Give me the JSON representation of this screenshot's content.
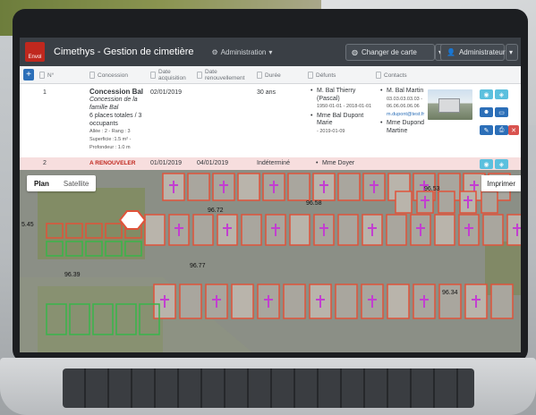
{
  "app": {
    "title": "Cimethys - Gestion de cimetière",
    "logo_text": "Envol",
    "admin_menu": "Administration",
    "change_map_button": "Changer de carte",
    "user_button": "Administrateur"
  },
  "table": {
    "headers": [
      "N°",
      "Concession",
      "Date acquisition",
      "Date renouvellement",
      "Durée",
      "Défunts",
      "Contacts"
    ],
    "row1": {
      "number": "1",
      "concession_title": "Concession Bal",
      "concession_family": "Concession de la famille Bal",
      "places": "6 places totales / 3 occupants",
      "details": [
        "Allée : 2 - Rang : 3",
        "Superficie :1.5 m² -",
        "Profondeur : 1.0 m"
      ],
      "date_acquisition": "02/01/2019",
      "date_renouvellement": "",
      "duree": "30 ans",
      "defunts": [
        {
          "name": "M. Bal Thierry (Pascal)",
          "dates": "1950-01-01 - 2018-01-01"
        },
        {
          "name": "Mme Bal Dupont Marie",
          "dates": "- 2019-01-09"
        }
      ],
      "contacts": [
        {
          "name": "M. Bal Martin",
          "phones": [
            "03.03.03.03.03 -",
            "06.06.06.06.06"
          ],
          "email": "m.dupont@test.fr"
        },
        {
          "name": "Mme Dupond Martine",
          "phones": [],
          "email": ""
        }
      ]
    },
    "row2": {
      "number": "2",
      "status": "A RENOUVELER",
      "date_acquisition": "01/01/2019",
      "date_renouvellement": "04/01/2019",
      "duree": "Indéterminé",
      "defunt": "Mme Doyer"
    }
  },
  "map": {
    "tabs": [
      "Plan",
      "Satellite"
    ],
    "active_tab": "Plan",
    "print_button": "Imprimer",
    "elevations": [
      "96.72",
      "96.58",
      "96.53",
      "96.77",
      "96.39",
      "96.34",
      "5.45"
    ]
  },
  "colors": {
    "header_bg": "#3a3f45",
    "accent_blue": "#2c6fb8",
    "danger": "#d9534f",
    "renew_row": "#f7dede",
    "plot_outline": "#e0533a",
    "plot_green": "#39b54a",
    "cross": "#c23fd0"
  },
  "icons": [
    "plus-icon",
    "gear-icon",
    "globe-icon",
    "user-icon",
    "caret-down-icon",
    "eye-icon",
    "map-marker-icon",
    "edit-icon",
    "print-icon",
    "delete-icon"
  ]
}
